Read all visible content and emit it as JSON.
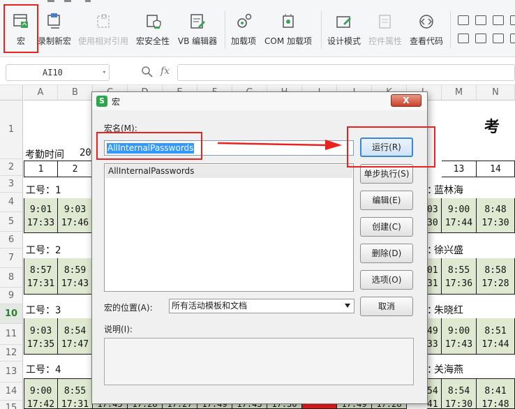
{
  "ribbon": {
    "buttons": [
      {
        "label": "宏",
        "icon": "macro-icon",
        "enabled": true
      },
      {
        "label": "录制新宏",
        "icon": "record-macro-icon",
        "enabled": true
      },
      {
        "label": "使用相对引用",
        "icon": "relative-reference-icon",
        "enabled": false
      },
      {
        "label": "宏安全性",
        "icon": "macro-security-icon",
        "enabled": true
      },
      {
        "label": "VB 编辑器",
        "icon": "vb-editor-icon",
        "enabled": true
      },
      {
        "label": "加载项",
        "icon": "addins-gear-icon",
        "enabled": true
      },
      {
        "label": "COM 加载项",
        "icon": "com-addins-icon",
        "enabled": true
      },
      {
        "label": "设计模式",
        "icon": "design-mode-icon",
        "enabled": true
      },
      {
        "label": "控件属性",
        "icon": "control-properties-icon",
        "enabled": false
      },
      {
        "label": "查看代码",
        "icon": "view-code-icon",
        "enabled": true
      }
    ]
  },
  "formula_bar": {
    "cell_ref": "AI10",
    "fx": "fx"
  },
  "grid": {
    "columns": [
      "A",
      "B",
      "C",
      "D",
      "E",
      "F",
      "G",
      "H",
      "I",
      "J",
      "K",
      "L",
      "M",
      "N"
    ],
    "rows": [
      "1",
      "2",
      "3",
      "4",
      "5",
      "6",
      "7",
      "8",
      "9",
      "10",
      "11",
      "12",
      "13",
      "14",
      "15"
    ],
    "selected_row": "10",
    "title_fragment": "考",
    "attendance_label": "考勤时间",
    "attendance_value": "20",
    "day_numbers": [
      "1",
      "2",
      "13",
      "14"
    ],
    "employees": [
      {
        "id_label": "工号：1",
        "name": "蓝林海",
        "prefix": "：",
        "left": [
          [
            "9:01",
            "17:33"
          ],
          [
            "9:03",
            "17:46"
          ]
        ],
        "right_clip": [
          "03",
          "30"
        ],
        "right": [
          [
            "9:00",
            "17:44"
          ],
          [
            "8:48",
            "17:30"
          ]
        ]
      },
      {
        "id_label": "工号：2",
        "name": "徐兴盛",
        "prefix": "：",
        "left": [
          [
            "8:57",
            "17:31"
          ],
          [
            "8:59",
            "17:43"
          ]
        ],
        "right_clip": [
          "01",
          "31"
        ],
        "right": [
          [
            "8:55",
            "17:36"
          ],
          [
            "8:58",
            "17:28"
          ]
        ]
      },
      {
        "id_label": "工号：3",
        "name": "朱晓红",
        "prefix": "：",
        "left": [
          [
            "9:03",
            "17:35"
          ],
          [
            "8:54",
            "17:47"
          ]
        ],
        "right_clip": [
          "49",
          "33"
        ],
        "right": [
          [
            "9:00",
            "17:43"
          ],
          [
            "8:51",
            "17:44"
          ]
        ]
      },
      {
        "id_label": "工号：4",
        "name": "关海燕",
        "prefix": "：",
        "left": [
          [
            "9:00",
            "17:42"
          ],
          [
            "8:55",
            "17:31"
          ]
        ],
        "right_clip": [
          "54",
          "41"
        ],
        "right": [
          [
            "8:54",
            "17:30"
          ],
          [
            "8:41",
            "17:48"
          ]
        ]
      }
    ],
    "bottom_row": [
      "17:45",
      "17:28",
      "17:27",
      "17:49",
      "17:43",
      "17:30",
      "",
      "17:49",
      "17:28"
    ]
  },
  "dialog": {
    "title": "宏",
    "close_label": "X",
    "macro_name_label": "宏名(M):",
    "macro_name_value": "AllInternalPasswords",
    "macro_list": [
      "AllInternalPasswords"
    ],
    "buttons": {
      "run": "运行(R)",
      "step": "单步执行(S)",
      "edit": "编辑(E)",
      "create": "创建(C)",
      "delete": "删除(D)",
      "options": "选项(O)",
      "cancel": "取消"
    },
    "location_label": "宏的位置(A):",
    "location_value": "所有活动模板和文档",
    "description_label": "说明(I):"
  },
  "colors": {
    "annotation_red": "#e8231f",
    "cell_green": "#dfe8d0",
    "selection_blue": "#3399ff",
    "run_border": "#3a86d6"
  }
}
